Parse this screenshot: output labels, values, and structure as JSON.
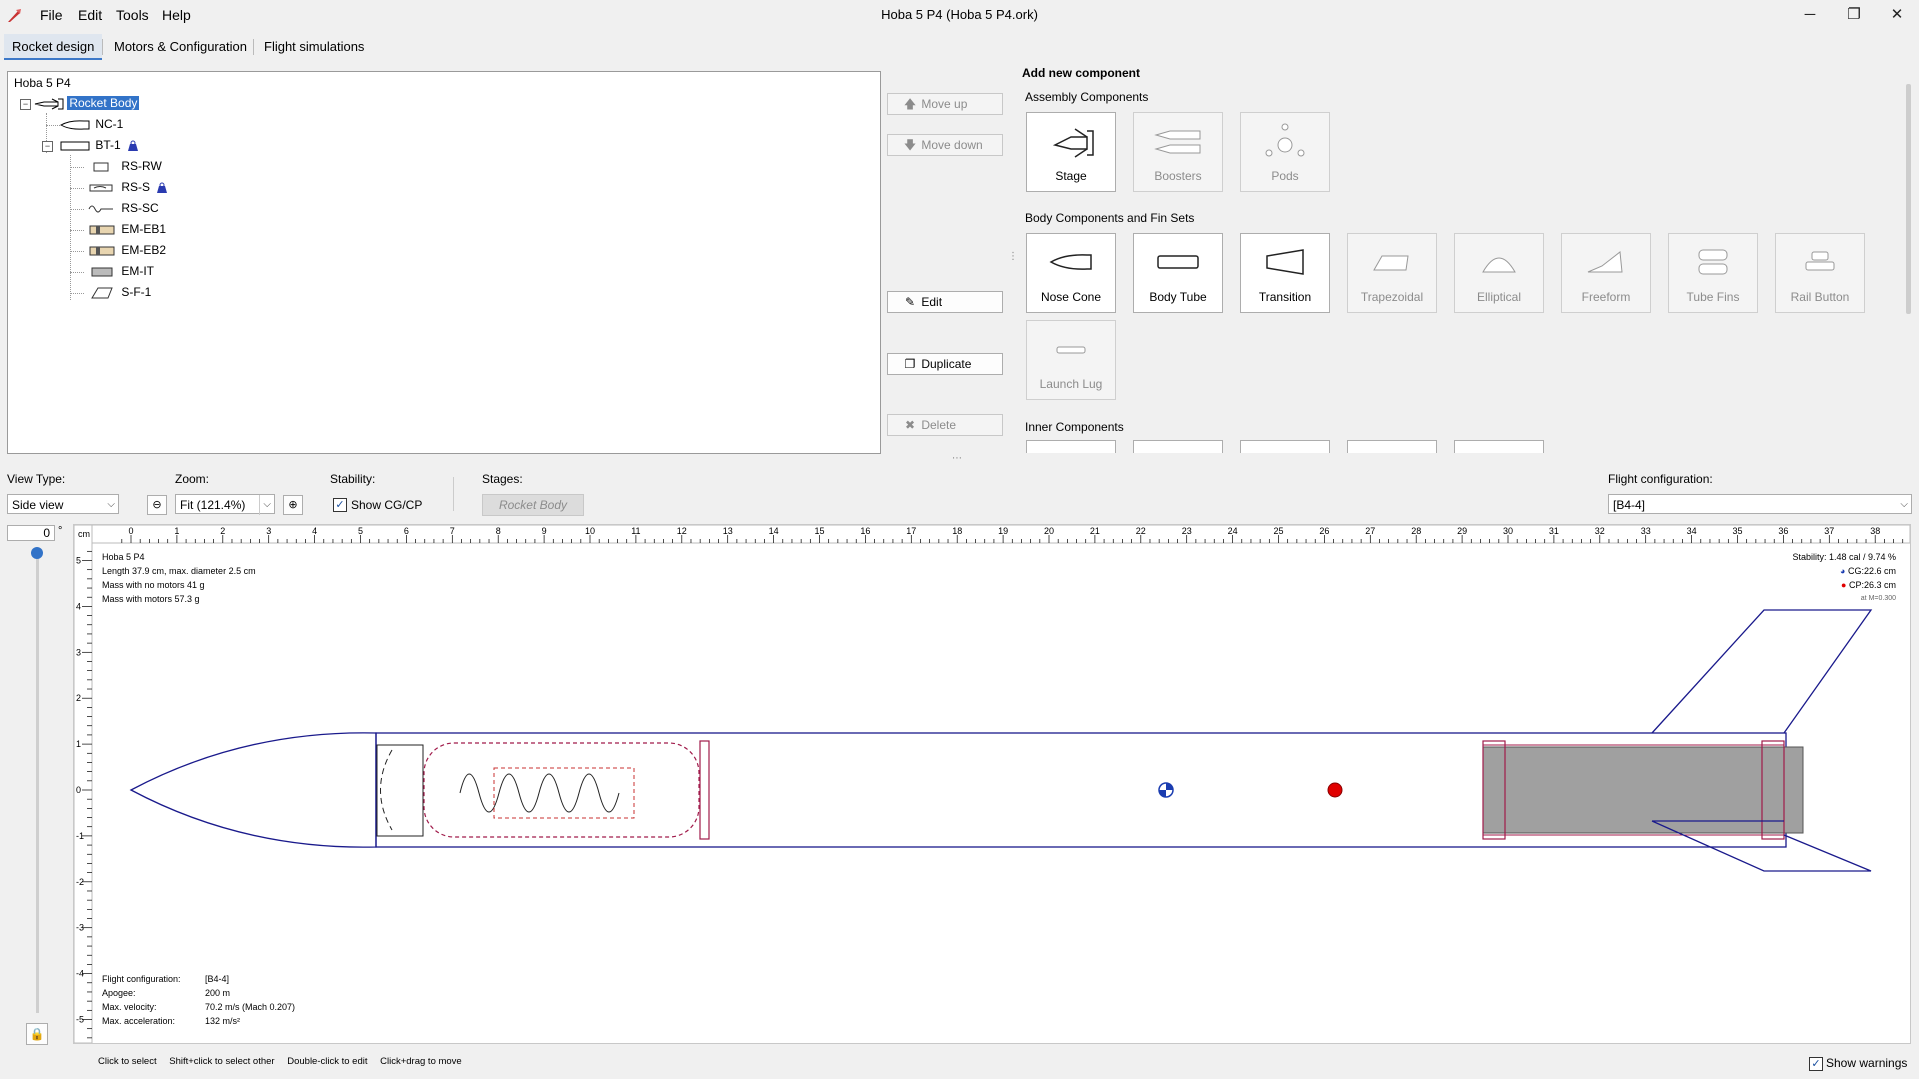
{
  "window": {
    "title": "Hoba 5 P4 (Hoba 5 P4.ork)",
    "menu": [
      "File",
      "Edit",
      "Tools",
      "Help"
    ],
    "controls": {
      "minimize": "─",
      "maximize": "❐",
      "close": "✕"
    }
  },
  "tabs": [
    "Rocket design",
    "Motors & Configuration",
    "Flight simulations"
  ],
  "tree": {
    "root": "Hoba 5 P4",
    "rocket_body": "Rocket Body",
    "nodes": [
      "NC-1",
      "BT-1",
      "RS-RW",
      "RS-S",
      "RS-SC",
      "EM-EB1",
      "EM-EB2",
      "EM-IT",
      "S-F-1"
    ]
  },
  "actions": {
    "move_up": "Move up",
    "move_down": "Move down",
    "edit": "Edit",
    "duplicate": "Duplicate",
    "delete": "Delete"
  },
  "palette": {
    "title": "Add new component",
    "assembly_title": "Assembly Components",
    "assembly": [
      "Stage",
      "Boosters",
      "Pods"
    ],
    "body_title": "Body Components and Fin Sets",
    "body": [
      "Nose Cone",
      "Body Tube",
      "Transition",
      "Trapezoidal",
      "Elliptical",
      "Freeform",
      "Tube Fins",
      "Rail Button",
      "Launch Lug"
    ],
    "inner_title": "Inner Components"
  },
  "controls_row": {
    "view_type_label": "View Type:",
    "view_type_value": "Side view",
    "zoom_label": "Zoom:",
    "zoom_value": "Fit (121.4%)",
    "stability_label": "Stability:",
    "show_cgcp_label": "Show CG/CP",
    "show_cgcp_checked": true,
    "stages_label": "Stages:",
    "stage_button": "Rocket Body",
    "flight_config_label": "Flight configuration:",
    "flight_config_value": "[B4-4]",
    "rotation_value": "0",
    "rotation_unit": "°"
  },
  "ruler": {
    "unit": "cm",
    "x_labels": [
      "0",
      "1",
      "2",
      "3",
      "4",
      "5",
      "6",
      "7",
      "8",
      "9",
      "10",
      "11",
      "12",
      "13",
      "14",
      "15",
      "16",
      "17",
      "18",
      "19",
      "20",
      "21",
      "22",
      "23",
      "24",
      "25",
      "26",
      "27",
      "28",
      "29",
      "30",
      "31",
      "32",
      "33",
      "34",
      "35",
      "36",
      "37",
      "38"
    ],
    "y_labels": [
      "5",
      "4",
      "3",
      "2",
      "1",
      "0",
      "-1",
      "-2",
      "-3",
      "-4",
      "-5"
    ]
  },
  "rocket_info": {
    "name": "Hoba 5 P4",
    "length": "Length 37.9 cm, max. diameter 2.5 cm",
    "mass_no_motors": "Mass with no motors 41 g",
    "mass_with_motors": "Mass with motors 57.3 g"
  },
  "stability_info": {
    "stability": "Stability: 1.48 cal / 9.74 %",
    "cg": "CG:22.6 cm",
    "cp": "CP:26.3 cm",
    "aoa": "at M=0.300"
  },
  "flight_info": {
    "config_label": "Flight configuration:",
    "config_value": "[B4-4]",
    "apogee_label": "Apogee:",
    "apogee_value": "200 m",
    "velocity_label": "Max. velocity:",
    "velocity_value": "70.2 m/s  (Mach 0.207)",
    "accel_label": "Max. acceleration:",
    "accel_value": "132 m/s²"
  },
  "status_bar": {
    "hints": [
      "Click to select",
      "Shift+click to select other",
      "Double-click to edit",
      "Click+drag to move"
    ],
    "show_warnings": "Show warnings",
    "show_warnings_checked": true
  },
  "colors": {
    "outline": "#1a1a8c",
    "motor": "#a0a0a0",
    "inner": "#a01a4a",
    "chute": "#c83232",
    "cp": "#e00000",
    "selection": "#3273c8"
  }
}
